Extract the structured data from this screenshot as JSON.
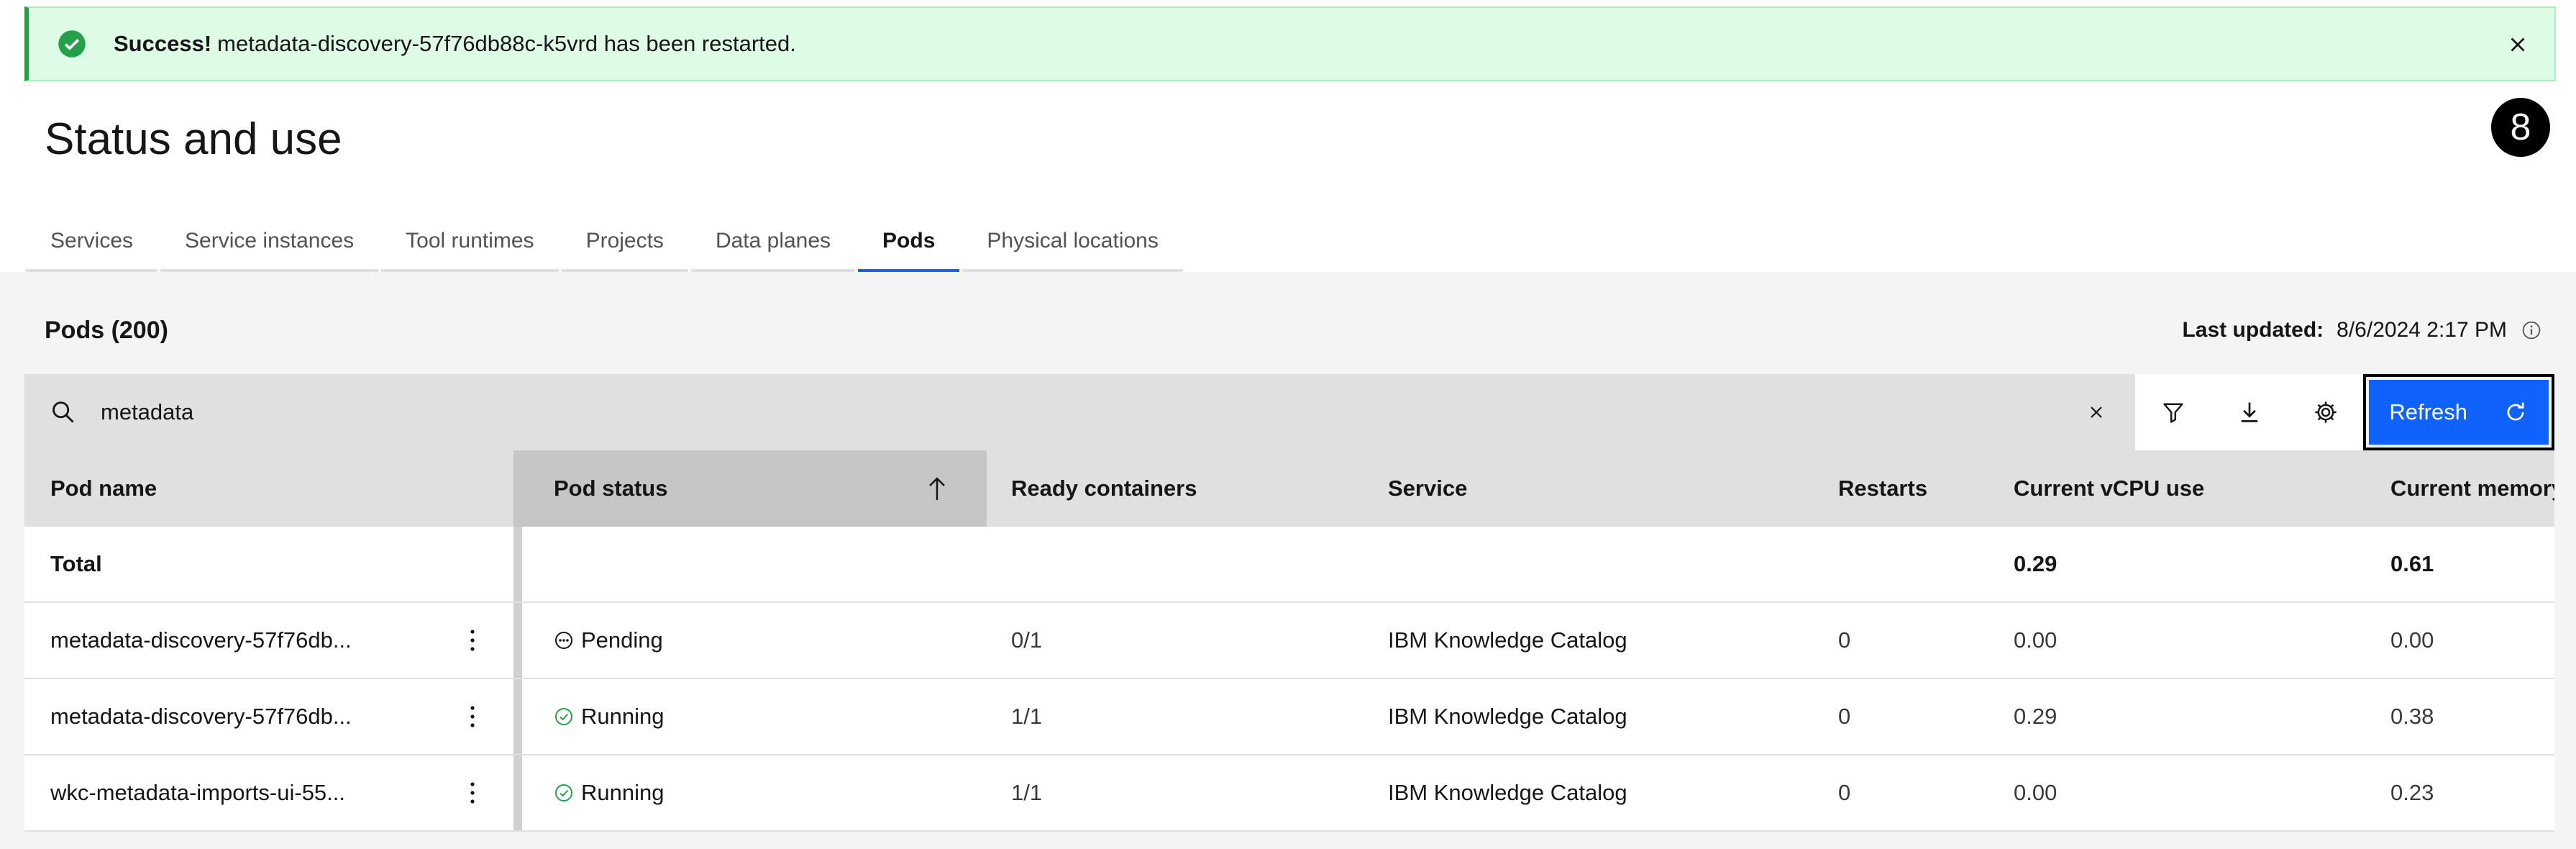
{
  "notification": {
    "title": "Success!",
    "message": "metadata-discovery-57f76db88c-k5vrd has been restarted.",
    "accent": "#24a148"
  },
  "page": {
    "title": "Status and use",
    "step_badge": "8"
  },
  "tabs": [
    {
      "label": "Services"
    },
    {
      "label": "Service instances"
    },
    {
      "label": "Tool runtimes"
    },
    {
      "label": "Projects"
    },
    {
      "label": "Data planes"
    },
    {
      "label": "Pods",
      "active": true
    },
    {
      "label": "Physical locations"
    }
  ],
  "pods": {
    "title": "Pods (200)",
    "last_updated_label": "Last updated:",
    "last_updated_value": "8/6/2024 2:17 PM"
  },
  "toolbar": {
    "search_value": "metadata",
    "refresh_label": "Refresh",
    "primary_color": "#0f62fe"
  },
  "table": {
    "headers": {
      "pod_name": "Pod name",
      "pod_status": "Pod status",
      "ready": "Ready containers",
      "service": "Service",
      "restarts": "Restarts",
      "vcpu": "Current vCPU use",
      "memory": "Current memory"
    },
    "total": {
      "label": "Total",
      "vcpu": "0.29",
      "memory": "0.61"
    },
    "rows": [
      {
        "name": "metadata-discovery-57f76db...",
        "status": "Pending",
        "ready": "0/1",
        "service": "IBM Knowledge Catalog",
        "restarts": "0",
        "vcpu": "0.00",
        "memory": "0.00"
      },
      {
        "name": "metadata-discovery-57f76db...",
        "status": "Running",
        "ready": "1/1",
        "service": "IBM Knowledge Catalog",
        "restarts": "0",
        "vcpu": "0.29",
        "memory": "0.38"
      },
      {
        "name": "wkc-metadata-imports-ui-55...",
        "status": "Running",
        "ready": "1/1",
        "service": "IBM Knowledge Catalog",
        "restarts": "0",
        "vcpu": "0.00",
        "memory": "0.23"
      }
    ]
  }
}
